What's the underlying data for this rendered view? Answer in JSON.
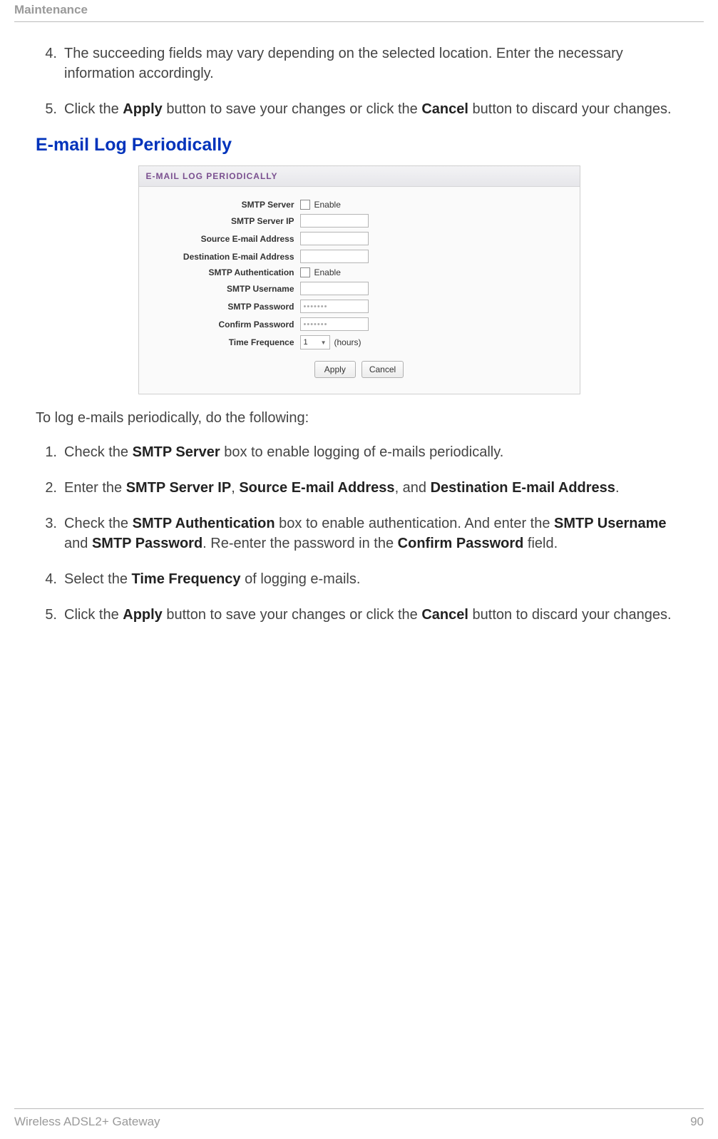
{
  "header": {
    "section": "Maintenance"
  },
  "intro_list": [
    {
      "num": "4.",
      "html": "The succeeding fields may vary depending on the selected location. Enter the necessary information accordingly."
    },
    {
      "num": "5.",
      "html": "Click the <b>Apply</b> button to save your changes or click the <b>Cancel</b> button to discard your changes."
    }
  ],
  "section_heading": "E-mail Log Periodically",
  "panel": {
    "title": "E-MAIL LOG PERIODICALLY",
    "rows": {
      "smtp_server_label": "SMTP Server",
      "smtp_server_enable": "Enable",
      "smtp_ip_label": "SMTP Server IP",
      "src_email_label": "Source E-mail Address",
      "dest_email_label": "Destination E-mail Address",
      "smtp_auth_label": "SMTP Authentication",
      "smtp_auth_enable": "Enable",
      "smtp_user_label": "SMTP Username",
      "smtp_pass_label": "SMTP Password",
      "smtp_pass_value": "•••••••",
      "confirm_pass_label": "Confirm Password",
      "confirm_pass_value": "•••••••",
      "time_freq_label": "Time Frequence",
      "time_freq_value": "1",
      "time_freq_unit": "(hours)"
    },
    "buttons": {
      "apply": "Apply",
      "cancel": "Cancel"
    }
  },
  "intro_line": "To log e-mails periodically, do the following:",
  "steps": [
    {
      "num": "1.",
      "html": "Check the <b>SMTP Server</b> box to enable logging of e-mails periodically."
    },
    {
      "num": "2.",
      "html": "Enter the <b>SMTP Server IP</b>, <b>Source E-mail Address</b>, and <b>Destination E-mail Address</b>."
    },
    {
      "num": "3.",
      "html": "Check the <b>SMTP Authentication</b> box to enable authentication. And enter the <b>SMTP Username</b> and <b>SMTP Password</b>. Re-enter the password in the <b>Confirm Password</b> field."
    },
    {
      "num": "4.",
      "html": "Select the <b>Time Frequency</b> of logging e-mails."
    },
    {
      "num": "5.",
      "html": "Click the <b>Apply</b> button to save your changes or click the <b>Cancel</b> button to discard your changes."
    }
  ],
  "footer": {
    "left": "Wireless ADSL2+ Gateway",
    "right": "90"
  }
}
